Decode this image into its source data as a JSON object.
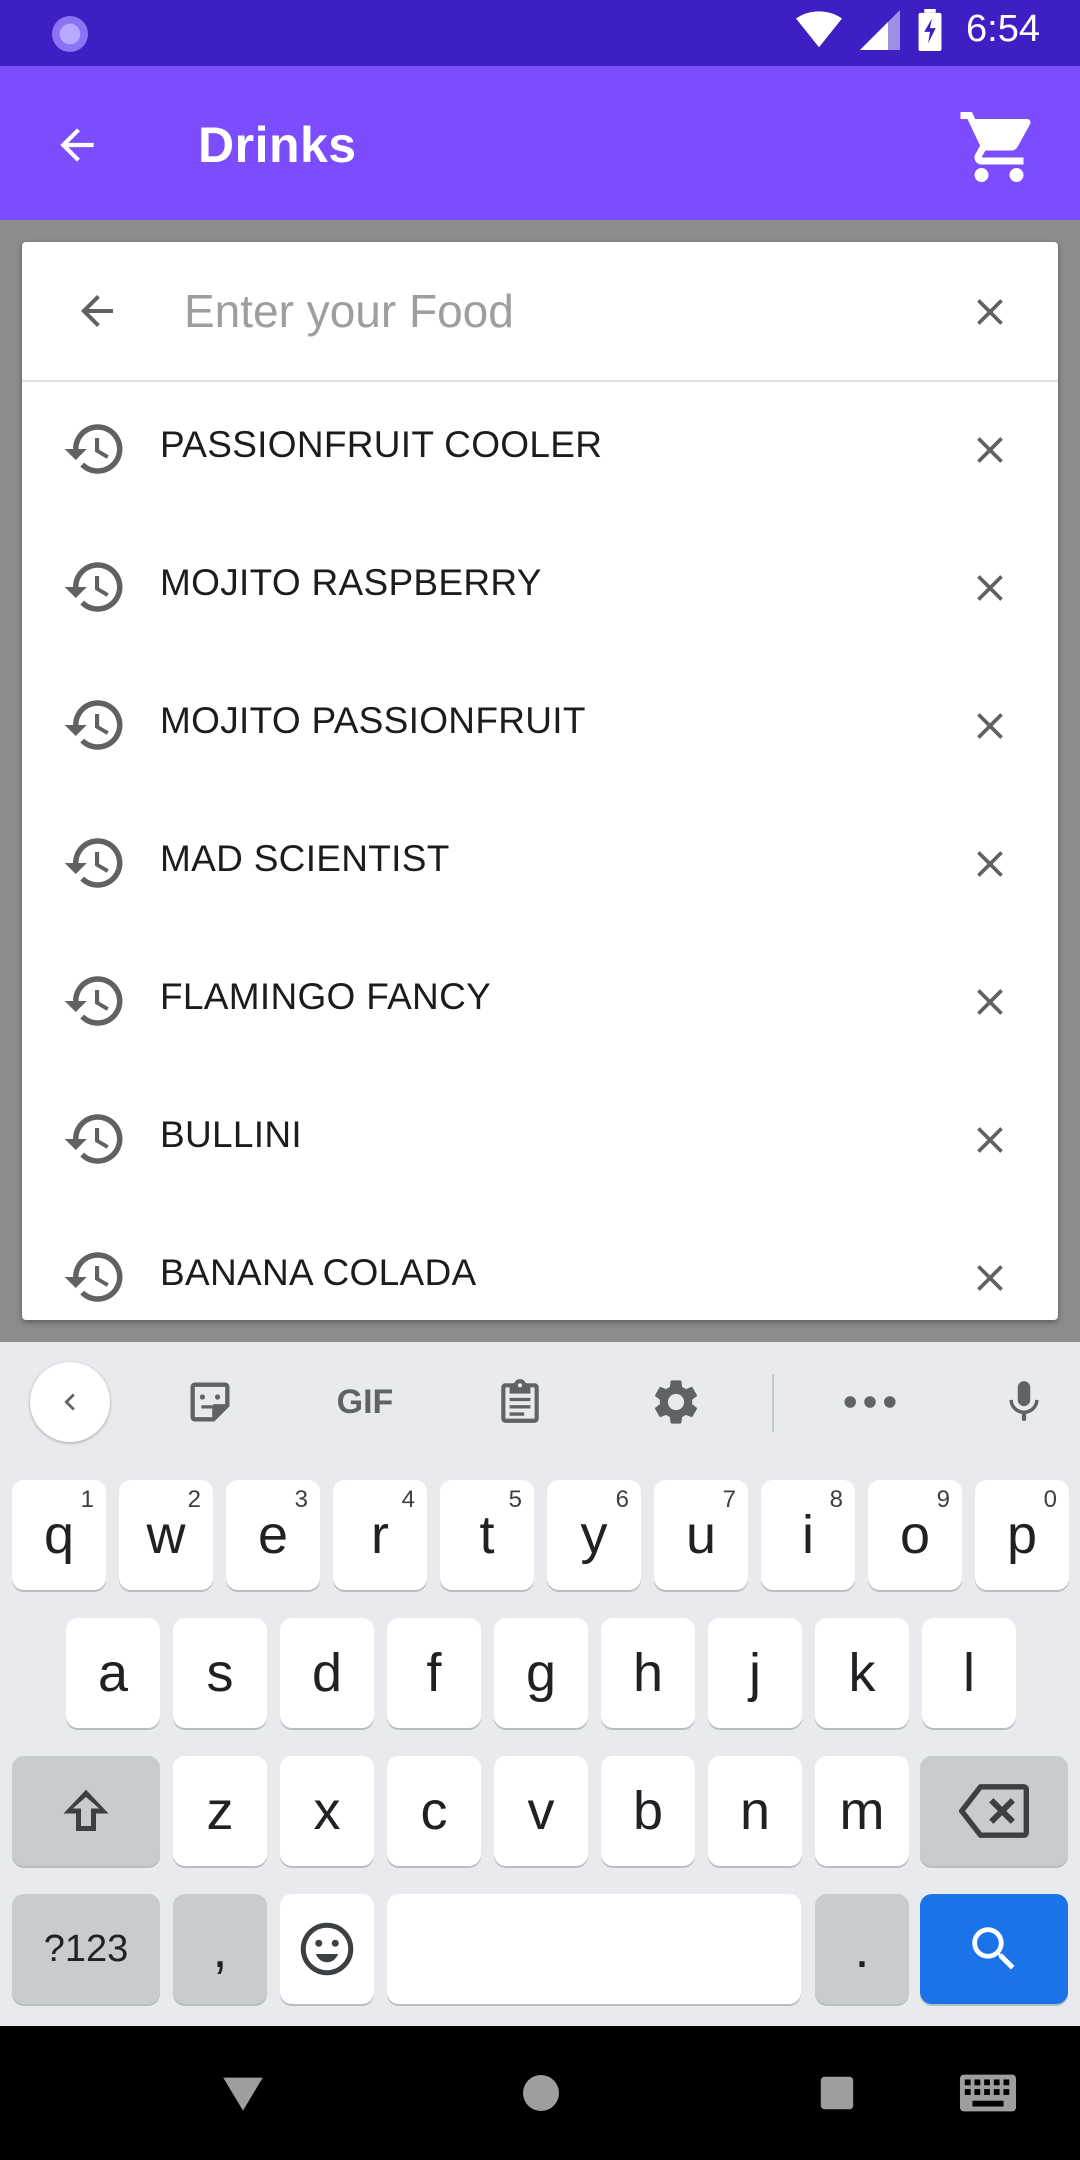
{
  "status_bar": {
    "time": "6:54"
  },
  "app_bar": {
    "title": "Drinks"
  },
  "search": {
    "placeholder": "Enter your Food",
    "value": ""
  },
  "history": [
    "PASSIONFRUIT COOLER",
    "MOJITO RASPBERRY",
    "MOJITO PASSIONFRUIT",
    "MAD SCIENTIST",
    "FLAMINGO FANCY",
    "BULLINI",
    "BANANA COLADA"
  ],
  "keyboard": {
    "toolbar": {
      "gif_label": "GIF"
    },
    "row1": [
      {
        "key": "q",
        "hint": "1"
      },
      {
        "key": "w",
        "hint": "2"
      },
      {
        "key": "e",
        "hint": "3"
      },
      {
        "key": "r",
        "hint": "4"
      },
      {
        "key": "t",
        "hint": "5"
      },
      {
        "key": "y",
        "hint": "6"
      },
      {
        "key": "u",
        "hint": "7"
      },
      {
        "key": "i",
        "hint": "8"
      },
      {
        "key": "o",
        "hint": "9"
      },
      {
        "key": "p",
        "hint": "0"
      }
    ],
    "row2": [
      "a",
      "s",
      "d",
      "f",
      "g",
      "h",
      "j",
      "k",
      "l"
    ],
    "row3": [
      "z",
      "x",
      "c",
      "v",
      "b",
      "n",
      "m"
    ],
    "symbols_label": "?123",
    "comma_label": ",",
    "period_label": "."
  },
  "colors": {
    "status_bar": "#3d1fc4",
    "app_bar": "#7c4dff",
    "action_key": "#1a73e8"
  }
}
